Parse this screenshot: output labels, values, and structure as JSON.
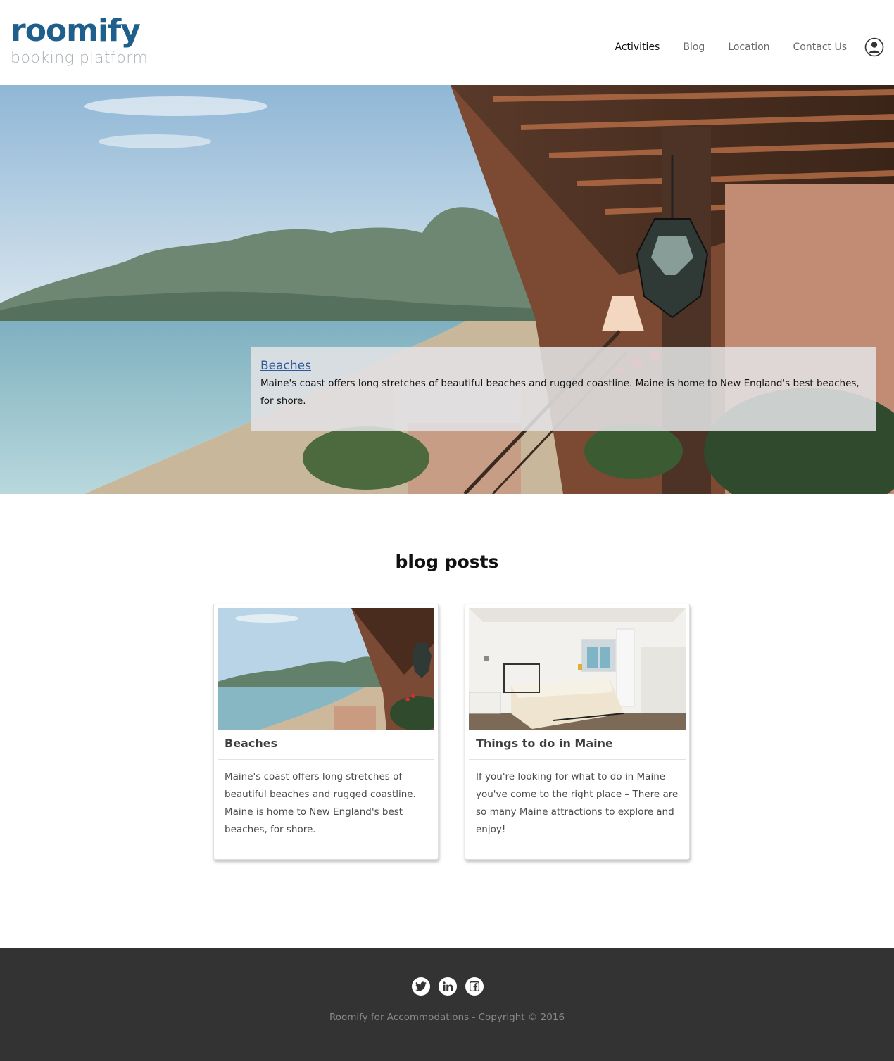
{
  "brand": {
    "name": "roomify",
    "tagline": "booking platform"
  },
  "nav": {
    "items": [
      {
        "label": "Activities",
        "active": true
      },
      {
        "label": "Blog",
        "active": false
      },
      {
        "label": "Location",
        "active": false
      },
      {
        "label": "Contact Us",
        "active": false
      }
    ],
    "user_icon": "user-circle-icon"
  },
  "hero": {
    "caption_title": "Beaches",
    "caption_text": "Maine's coast offers long stretches of beautiful beaches and rugged coastline. Maine is home to New England's best beaches, for shore."
  },
  "blog": {
    "title": "blog posts",
    "posts": [
      {
        "title": "Beaches",
        "excerpt": "Maine's coast offers long stretches of beautiful beaches and rugged coastline. Maine is home to New England's best beaches, for shore.",
        "image": "beach-balcony-photo"
      },
      {
        "title": "Things to do in Maine",
        "excerpt": "If you're looking for what to do in Maine you've come to the right place – There are so many Maine attractions to explore and enjoy!",
        "image": "bedroom-photo"
      }
    ]
  },
  "footer": {
    "social": [
      "twitter-icon",
      "linkedin-icon",
      "facebook-icon"
    ],
    "copyright": "Roomify for Accommodations - Copyright © 2016"
  },
  "colors": {
    "brand": "#1f5f8c",
    "footer_bg": "#333333",
    "link": "#2d5a9b"
  }
}
